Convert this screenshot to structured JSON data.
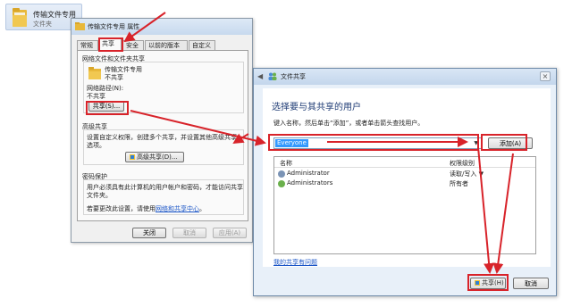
{
  "desktop_folder": {
    "name": "传输文件专用",
    "type": "文件夹",
    "icon": "folder-icon"
  },
  "properties_dialog": {
    "title": "传输文件专用 属性",
    "tabs": [
      {
        "label": "常规"
      },
      {
        "label": "共享"
      },
      {
        "label": "安全"
      },
      {
        "label": "以前的版本"
      },
      {
        "label": "自定义"
      }
    ],
    "active_tab": "共享",
    "network_sharing": {
      "heading": "网络文件和文件夹共享",
      "folder_name": "传输文件专用",
      "folder_state": "不共享",
      "path_label": "网络路径(N):",
      "path_value": "不共享",
      "share_button": "共享(S)..."
    },
    "advanced_sharing": {
      "heading": "高级共享",
      "description_1": "设置自定义权限，创建多个共享，并设置其他高级共享",
      "description_2": "选项。",
      "button": "高级共享(D)..."
    },
    "password_protection": {
      "heading": "密码保护",
      "line_1": "用户必须具有此计算机的用户帐户和密码，才能访问共享",
      "line_2": "文件夹。",
      "line_3_prefix": "若要更改此设置，请使用",
      "link": "网络和共享中心",
      "line_3_suffix": "。"
    },
    "buttons": {
      "close": "关闭",
      "cancel": "取消",
      "apply": "应用(A)"
    }
  },
  "sharing_wizard": {
    "title": "文件共享",
    "heading": "选择要与其共享的用户",
    "instruction": "键入名称，然后单击“添加”，或者单击箭头查找用户。",
    "input_value": "Everyone",
    "add_button": "添加(A)",
    "columns": {
      "name": "名称",
      "permission": "权限级别"
    },
    "users": [
      {
        "name": "Administrator",
        "permission": "读取/写入 ▼"
      },
      {
        "name": "Administrators",
        "permission": "所有者"
      }
    ],
    "help_link": "我的共享有问题",
    "share_button": "共享(H)",
    "cancel_button": "取消"
  },
  "colors": {
    "highlight": "#d8232a",
    "link": "#1a55c7",
    "heading": "#1e3b74",
    "selection": "#3399ff"
  }
}
